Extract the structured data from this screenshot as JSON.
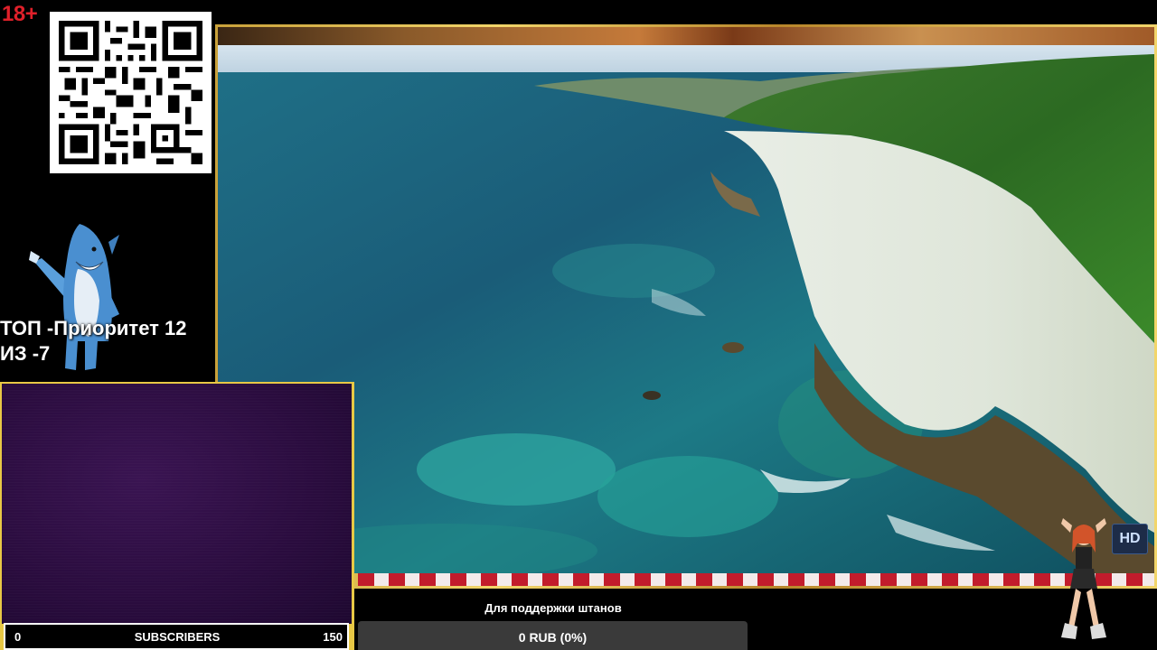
{
  "overlay": {
    "age_rating": "18+",
    "priority_line1": "ТОП -Приоритет 12",
    "priority_line2": "ИЗ -7",
    "hd_badge": "HD"
  },
  "subscribers": {
    "min": "0",
    "label": "SUBSCRIBERS",
    "max": "150",
    "progress": 0
  },
  "donation": {
    "title": "Для поддержки штанов",
    "value": "0 RUB (0%)",
    "progress": 0
  },
  "colors": {
    "frame_gold": "#e8c845",
    "age_red": "#e0202a",
    "cam_purple": "#2a0c3e"
  },
  "icons": [
    "qr-code-icon",
    "shark-mascot-icon",
    "dancer-icon",
    "hd-icon"
  ]
}
